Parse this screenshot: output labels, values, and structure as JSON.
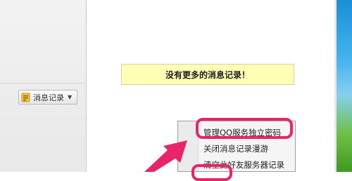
{
  "sidebar": {
    "message_record_button": {
      "label": "消息记录",
      "icon": "note-icon",
      "caret_icon": "dropdown-caret-icon"
    }
  },
  "main": {
    "notice_text": "没有更多的消息记录！"
  },
  "context_menu": {
    "items": [
      {
        "label": "管理QQ服务独立密码"
      },
      {
        "label": "关闭消息记录漫游"
      },
      {
        "label": "清空此好友服务器记录"
      }
    ]
  },
  "annotations": {
    "highlight_color": "#e8246a",
    "notice_background": "#ffffb5"
  }
}
